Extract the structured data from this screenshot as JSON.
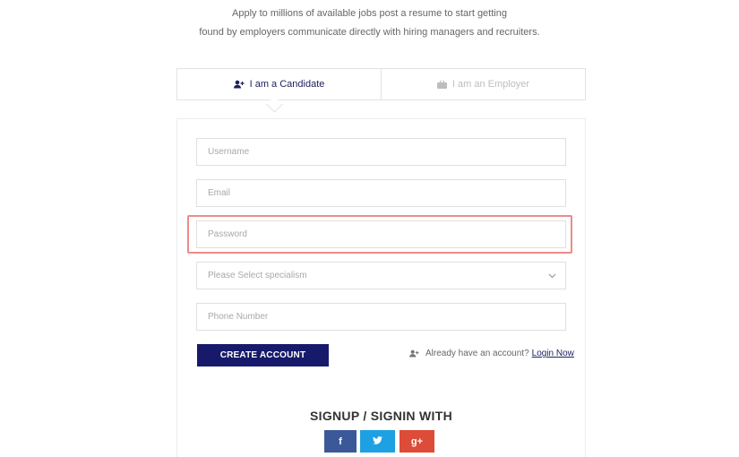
{
  "intro": {
    "line1": "Apply to millions of available jobs post a resume to start getting",
    "line2": "found by employers communicate directly with hiring managers and recruiters."
  },
  "tabs": [
    {
      "label": "I am a Candidate",
      "icon": "user-plus-icon",
      "active": true
    },
    {
      "label": "I am an Employer",
      "icon": "briefcase-icon",
      "active": false
    }
  ],
  "form": {
    "username_placeholder": "Username",
    "email_placeholder": "Email",
    "password_placeholder": "Password",
    "specialism_selected": "Please Select specialism",
    "phone_placeholder": "Phone Number",
    "create_button": "CREATE ACCOUNT",
    "already_text": "Already have an account?",
    "login_link": "Login Now"
  },
  "social": {
    "title": "SIGNUP / SIGNIN WITH",
    "facebook": "f",
    "twitter": "twitter",
    "google": "g+"
  },
  "colors": {
    "primary": "#171a6b",
    "highlight": "#f08a8a",
    "facebook": "#3b5998",
    "twitter": "#1da1e2",
    "google": "#dd4b39"
  }
}
